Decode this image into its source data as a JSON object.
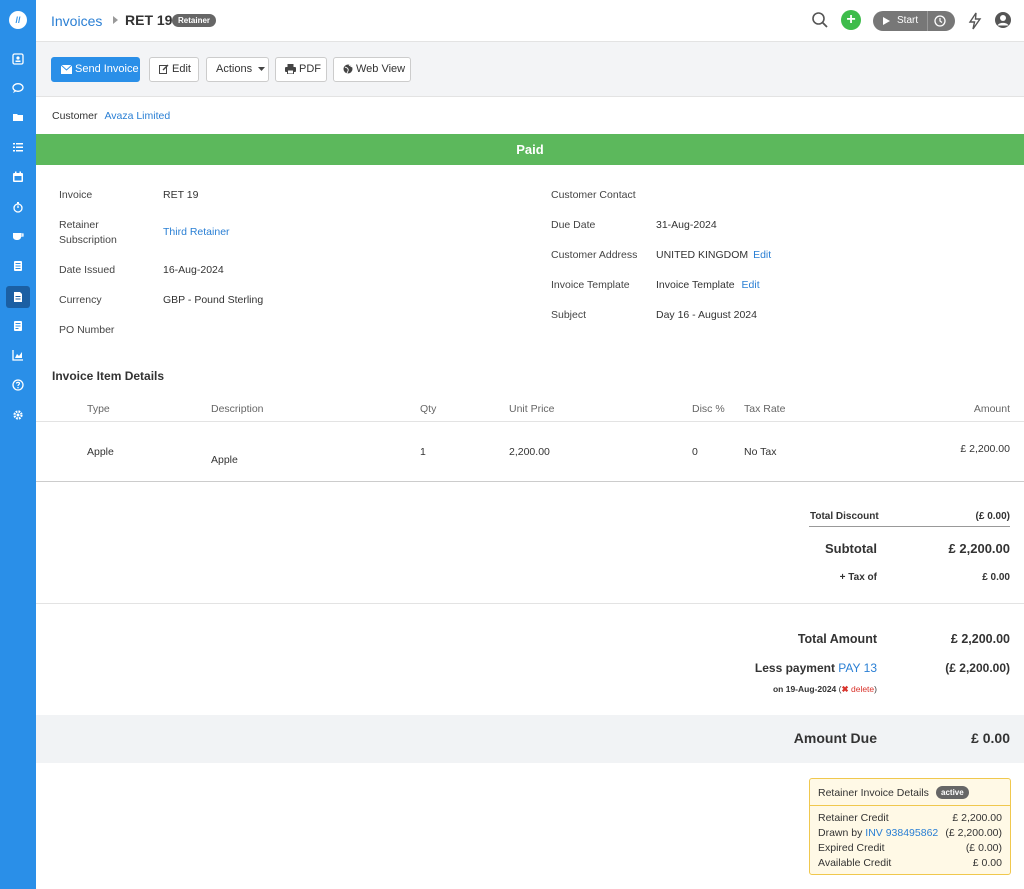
{
  "breadcrumb": {
    "parent": "Invoices",
    "current": "RET 19",
    "badge": "Retainer"
  },
  "topbar": {
    "start_label": "Start"
  },
  "toolbar": {
    "send": "Send Invoice",
    "edit": "Edit",
    "actions": "Actions",
    "pdf": "PDF",
    "webview": "Web View"
  },
  "customer": {
    "label": "Customer",
    "name": "Avaza Limited"
  },
  "status": "Paid",
  "details_left": [
    {
      "label": "Invoice",
      "value": "RET 19"
    },
    {
      "label": "Retainer",
      "label2": "Subscription",
      "value": "Third Retainer"
    },
    {
      "label": "Date Issued",
      "value": "16-Aug-2024"
    },
    {
      "label": "Currency",
      "value": "GBP - Pound Sterling"
    },
    {
      "label": "PO Number",
      "value": ""
    }
  ],
  "details_right": [
    {
      "label": "Customer Contact",
      "value": ""
    },
    {
      "label": "Due Date",
      "value": "31-Aug-2024"
    },
    {
      "label": "Customer Address",
      "value": "UNITED KINGDOM",
      "edit": "Edit"
    },
    {
      "label": "Invoice Template",
      "value": "Invoice Template",
      "edit": "Edit"
    },
    {
      "label": "Subject",
      "value": "Day 16 - August 2024"
    }
  ],
  "items": {
    "title": "Invoice Item Details",
    "columns": [
      "Type",
      "Description",
      "Qty",
      "Unit Price",
      "Disc %",
      "Tax Rate",
      "Amount"
    ],
    "rows": [
      {
        "type": "Apple",
        "description": "Apple",
        "qty": "1",
        "unit_price": "2,200.00",
        "disc": "0",
        "tax": "No Tax",
        "amount": "£ 2,200.00"
      }
    ]
  },
  "totals": {
    "discount_label": "Total Discount",
    "discount_value": "(£ 0.00)",
    "subtotal_label": "Subtotal",
    "subtotal_value": "£ 2,200.00",
    "tax_label": "+ Tax of",
    "tax_value": "£ 0.00",
    "total_label": "Total Amount",
    "total_value": "£ 2,200.00",
    "less_payment_label": "Less payment",
    "payment_ref": "PAY 13",
    "payment_value": "(£ 2,200.00)",
    "payment_date": "on 19-Aug-2024",
    "delete_label": "delete",
    "due_label": "Amount Due",
    "due_value": "£ 0.00"
  },
  "retainer": {
    "title": "Retainer Invoice Details",
    "status": "active",
    "credit_label": "Retainer Credit",
    "credit_value": "£ 2,200.00",
    "drawn_label": "Drawn by",
    "drawn_ref": "INV 938495862",
    "drawn_value": "(£ 2,200.00)",
    "expired_label": "Expired Credit",
    "expired_value": "(£ 0.00)",
    "available_label": "Available Credit",
    "available_value": "£ 0.00"
  },
  "colors": {
    "sidebar": "#2a8fe8",
    "paid": "#5cb85c",
    "link": "#2a7fd4",
    "delete": "#d9332b"
  }
}
